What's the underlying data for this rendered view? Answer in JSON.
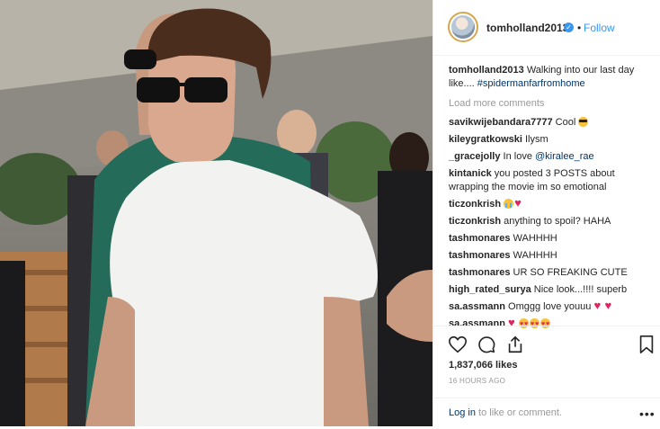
{
  "post": {
    "photo_description_icon": "post-photo",
    "header": {
      "username": "tomholland2013",
      "verified_mark": "✓",
      "separator": "•",
      "follow_label": "Follow"
    },
    "caption": {
      "username": "tomholland2013",
      "text": "Walking into our last day like.... ",
      "hashtag": "#spidermanfarfromhome"
    },
    "load_more_label": "Load more comments",
    "comments": [
      {
        "user": "savikwijebandara7777",
        "text": "Cool",
        "emojis": [
          "sunglasses-emoji"
        ]
      },
      {
        "user": "kileygratkowski",
        "text": "Ilysm",
        "emojis": []
      },
      {
        "user": "_gracejolly",
        "text": "In love ",
        "mention": "@kiralee_rae",
        "emojis": []
      },
      {
        "user": "kintanick",
        "text": "you posted 3 POSTS about wrapping the movie im so emotional",
        "emojis": []
      },
      {
        "user": "ticzonkrish",
        "text": "",
        "emojis": [
          "crying-emoji",
          "heart-emoji"
        ]
      },
      {
        "user": "ticzonkrish",
        "text": "anything to spoil? HAHA",
        "emojis": []
      },
      {
        "user": "tashmonares",
        "text": "WAHHHH",
        "emojis": []
      },
      {
        "user": "tashmonares",
        "text": "WAHHHH",
        "emojis": []
      },
      {
        "user": "tashmonares",
        "text": "UR SO FREAKING CUTE",
        "emojis": []
      },
      {
        "user": "high_rated_surya",
        "text": "Nice look...!!!! superb",
        "emojis": []
      },
      {
        "user": "sa.assmann",
        "text": "Omggg love youuu",
        "emojis": [
          "heart-emoji",
          "heart-emoji"
        ]
      },
      {
        "user": "sa.assmann",
        "text": "",
        "emojis": [
          "heart-emoji",
          "heart-eyes-emoji",
          "heart-eyes-emoji",
          "heart-eyes-emoji"
        ]
      }
    ],
    "likes": "1,837,066 likes",
    "time_ago": "16 HOURS AGO",
    "footer": {
      "login_link": "Log in",
      "login_rest": " to like or comment.",
      "more_label": "•••"
    },
    "icons": [
      "heart-icon",
      "comment-icon",
      "share-icon",
      "bookmark-icon"
    ],
    "colors": {
      "accent": "#3897f0",
      "text": "#262626",
      "muted": "#999999",
      "link": "#003569"
    }
  }
}
